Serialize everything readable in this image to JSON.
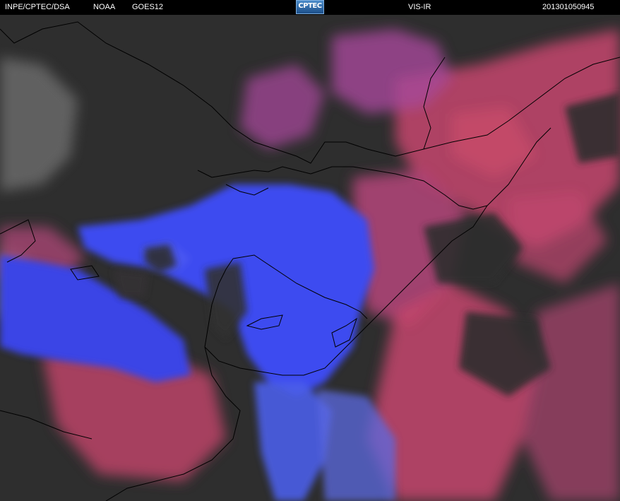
{
  "header": {
    "institution": "INPE/CPTEC/DSA",
    "agency": "NOAA",
    "satellite": "GOES12",
    "logo_text": "CPTEC",
    "product": "VIS-IR",
    "timestamp": "201301050945"
  },
  "colors": {
    "header_bg": "#000000",
    "ground": "#2e2e2e",
    "low_cloud": "#3d4cf0",
    "high_cloud": "#c8436e",
    "borders": "#000000"
  }
}
